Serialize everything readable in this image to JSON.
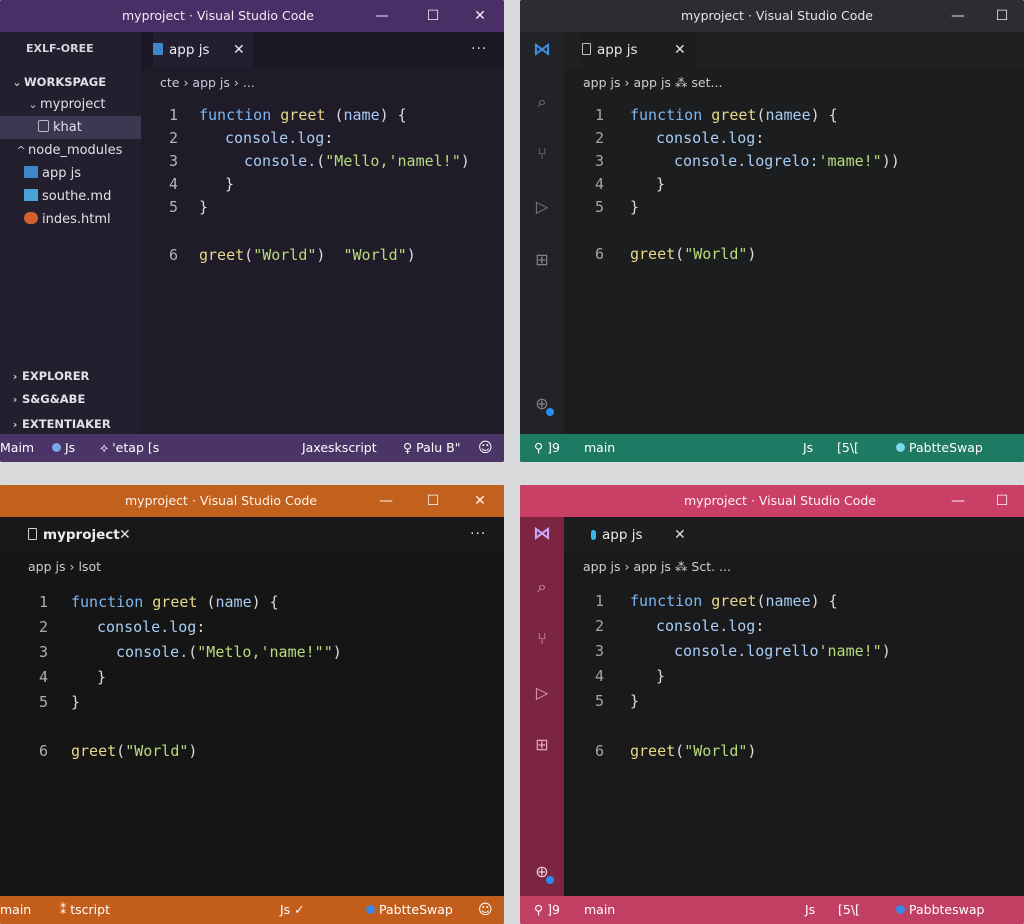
{
  "windows": [
    {
      "title": {
        "project": "myproject",
        "app": "Visual Studio Code"
      },
      "controls": {
        "minimize": "—",
        "maximize": "☐",
        "close": "✕"
      },
      "sidebar": {
        "header": "EXLF-OREE",
        "workspace": "WORKSPAGE",
        "project": "myproject",
        "items": [
          "khat",
          "node_modules",
          "app js",
          "southe.md",
          "indes.html"
        ],
        "sections": [
          "EXPLORER",
          "S&G&ABE",
          "EXTENTIAKER"
        ]
      },
      "tab": {
        "label": "app js",
        "close": "✕",
        "more": "···"
      },
      "breadcrumb": [
        "cte",
        "app js",
        "..."
      ],
      "code": {
        "line_numbers": [
          "1",
          "2",
          "3",
          "4",
          "5",
          "6"
        ],
        "l1": {
          "kw": "function",
          "fn": "greet",
          "open": " (",
          "pm": "name",
          "close": ") {"
        },
        "l2": {
          "obj": "console.log",
          "punct": ":"
        },
        "l3": {
          "obj": "console.",
          "open": "(",
          "s1": "\"Mello,",
          "s2": "'namel!\"",
          "close": ")"
        },
        "l4": "}",
        "l5": "}",
        "l6": {
          "fn": "greet",
          "open": "(",
          "s1": "\"World\"",
          "close": ")",
          "gap": "  ",
          "s2": "\"World\"",
          "end": ")"
        }
      },
      "status": {
        "branch": "Maim",
        "lang": "Js",
        "sync": "'etap [s",
        "mode": "Jaxeskscript",
        "extra": "Palu B\"",
        "feedback": "☺"
      }
    },
    {
      "title": {
        "project": "myproject",
        "app": "Visual Studio Code"
      },
      "controls": {
        "minimize": "—",
        "maximize": "☐"
      },
      "tab": {
        "label": "app js",
        "close": "✕"
      },
      "breadcrumb": [
        "app js",
        "app js",
        "set..."
      ],
      "code": {
        "line_numbers": [
          "1",
          "2",
          "3",
          "4",
          "5",
          "6"
        ],
        "l1": {
          "kw": "function",
          "fn": "greet",
          "open": "(",
          "pm": "namee",
          "close": ") {"
        },
        "l2": {
          "obj": "console.log",
          "punct": ":"
        },
        "l3": {
          "obj": "console.logrelo:",
          "s1": "'mame!\"",
          "close": "))"
        },
        "l4": "}",
        "l5": "}",
        "l6": {
          "fn": "greet",
          "open": "(",
          "s1": "\"World\"",
          "close": ")"
        }
      },
      "status": {
        "remote": "]9",
        "branch": "main",
        "lang": "Js",
        "pos": "[5\\[",
        "ext": "PabtteSwap",
        "color": "#1f7a63"
      }
    },
    {
      "title": {
        "project": "myproject",
        "app": "Visual Studio Code"
      },
      "controls": {
        "minimize": "—",
        "maximize": "☐",
        "close": "✕"
      },
      "tab": {
        "label": "myproject",
        "close": "✕",
        "more": "···"
      },
      "breadcrumb": [
        "app js",
        "lsot"
      ],
      "code": {
        "line_numbers": [
          "1",
          "2",
          "3",
          "4",
          "5",
          "6"
        ],
        "l1": {
          "kw": "function",
          "fn": "greet",
          "open": " (",
          "pm": "name",
          "close": ") {"
        },
        "l2": {
          "obj": "console.log",
          "punct": ":"
        },
        "l3": {
          "obj": "console.",
          "open": "(",
          "s1": "\"Metlo,",
          "s2": "'name!\"\"",
          "close": ")"
        },
        "l4": "}",
        "l5": "}",
        "l6": {
          "fn": "greet",
          "open": "(",
          "s1": "\"World\"",
          "close": ")"
        }
      },
      "status": {
        "branch": "main",
        "sync": "tscript",
        "lang": "Js ✓",
        "ext": "PabtteSwap",
        "feedback": "☺"
      }
    },
    {
      "title": {
        "project": "myproject",
        "app": "Visual Studio Code"
      },
      "controls": {
        "minimize": "—",
        "maximize": "☐"
      },
      "tab": {
        "label": "app js",
        "close": "✕"
      },
      "breadcrumb": [
        "app js",
        "app js",
        "Sct. ..."
      ],
      "code": {
        "line_numbers": [
          "1",
          "2",
          "3",
          "4",
          "5",
          "6"
        ],
        "l1": {
          "kw": "function",
          "fn": "greet",
          "open": "(",
          "pm": "namee",
          "close": ") {"
        },
        "l2": {
          "obj": "console.log",
          "punct": ":"
        },
        "l3": {
          "obj": "console.logrello",
          "s1": "'name!\"",
          "close": ")"
        },
        "l4": "}",
        "l5": "}",
        "l6": {
          "fn": "greet",
          "open": "(",
          "s1": "\"World\"",
          "close": ")"
        }
      },
      "status": {
        "remote": "]9",
        "branch": "main",
        "lang": "Js",
        "pos": "[5\\[",
        "ext": "Pabbteswap"
      }
    }
  ],
  "colors": {
    "w1_frame": "#4a2f66",
    "w2_frame": "#2b2d30",
    "w3_frame": "#c2601e",
    "w4_frame": "#c93f66",
    "status_green": "#1f7a63",
    "status_purple": "#4b3466",
    "status_orange": "#c35d1c",
    "status_pink": "#c23f64",
    "keyword": "#7cb6f2",
    "function": "#e7d88a",
    "string": "#b8dc7c"
  },
  "icons": [
    "explorer-icon",
    "search-icon",
    "source-control-icon",
    "run-debug-icon",
    "extensions-icon",
    "accounts-icon",
    "file-icon",
    "chevron-icon",
    "close-icon"
  ]
}
